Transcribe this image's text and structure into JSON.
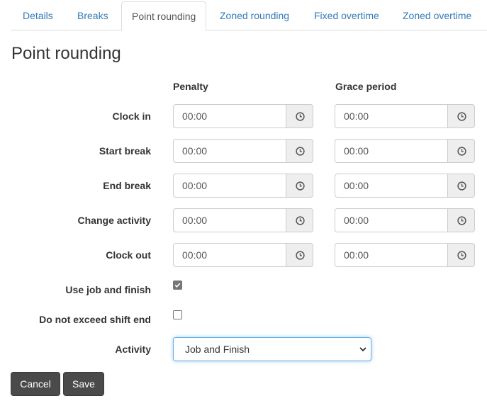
{
  "tabs": [
    {
      "label": "Details",
      "active": false
    },
    {
      "label": "Breaks",
      "active": false
    },
    {
      "label": "Point rounding",
      "active": true
    },
    {
      "label": "Zoned rounding",
      "active": false
    },
    {
      "label": "Fixed overtime",
      "active": false
    },
    {
      "label": "Zoned overtime",
      "active": false
    }
  ],
  "page": {
    "title": "Point rounding"
  },
  "columns": {
    "penalty": "Penalty",
    "grace": "Grace period"
  },
  "rows": [
    {
      "label": "Clock in",
      "penalty": "00:00",
      "grace": "00:00"
    },
    {
      "label": "Start break",
      "penalty": "00:00",
      "grace": "00:00"
    },
    {
      "label": "End break",
      "penalty": "00:00",
      "grace": "00:00"
    },
    {
      "label": "Change activity",
      "penalty": "00:00",
      "grace": "00:00"
    },
    {
      "label": "Clock out",
      "penalty": "00:00",
      "grace": "00:00"
    }
  ],
  "options": {
    "use_job_and_finish": {
      "label": "Use job and finish",
      "checked": true
    },
    "do_not_exceed_shift_end": {
      "label": "Do not exceed shift end",
      "checked": false
    }
  },
  "activity": {
    "label": "Activity",
    "selected": "Job and Finish"
  },
  "buttons": {
    "cancel": "Cancel",
    "save": "Save"
  },
  "icons": {
    "time_addon": "clock-icon",
    "select_caret": "chevron-down-icon",
    "checkbox_mark": "check-icon"
  },
  "colors": {
    "tab_link": "#337ab7",
    "tab_active_text": "#555555",
    "button_bg": "#4a4a4a",
    "focus_border": "#66afe9",
    "addon_bg": "#eeeeee"
  }
}
